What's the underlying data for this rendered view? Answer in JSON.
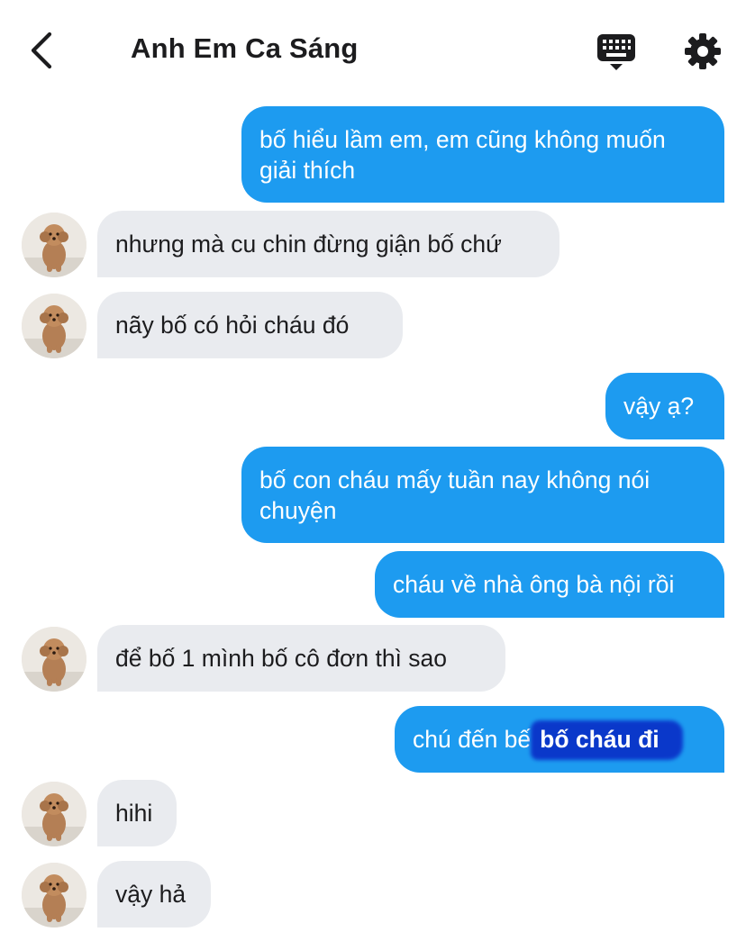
{
  "header": {
    "title": "Anh Em Ca Sáng",
    "icons": [
      "chevron-left-icon",
      "keyboard-icon",
      "gear-icon"
    ]
  },
  "colors": {
    "outgoing_bubble": "#1d9bf0",
    "incoming_bubble": "#e9ebef",
    "scribble": "#0a33c9"
  },
  "messages": [
    {
      "direction": "out",
      "text": "bố hiểu lầm em, em cũng không muốn giải thích"
    },
    {
      "direction": "in",
      "text": "nhưng mà cu chin đừng giận bố chứ"
    },
    {
      "direction": "in",
      "text": "nãy bố có hỏi cháu đó"
    },
    {
      "direction": "out",
      "text": "vậy ạ?"
    },
    {
      "direction": "out",
      "text": "bố con cháu mấy tuần nay không nói chuyện"
    },
    {
      "direction": "out",
      "text": "cháu về nhà ông bà nội rồi"
    },
    {
      "direction": "in",
      "text": "để bố 1 mình bố cô đơn thì sao"
    },
    {
      "direction": "out",
      "text": "chú đến bế",
      "highlighted_text": "bố cháu đi"
    },
    {
      "direction": "in",
      "text": "hihi"
    },
    {
      "direction": "in",
      "text": "vậy hả"
    }
  ]
}
